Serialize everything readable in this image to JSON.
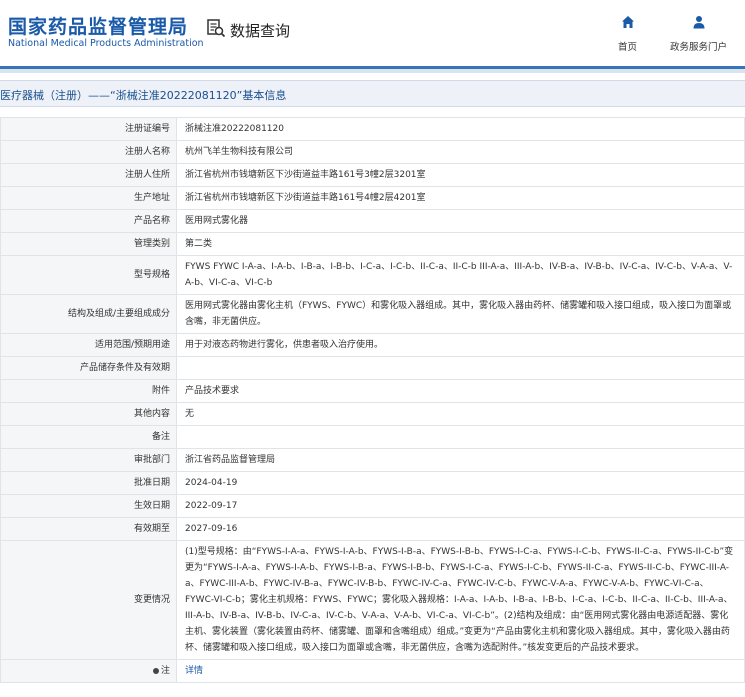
{
  "header": {
    "logo_cn": "国家药品监督管理局",
    "logo_en": "National Medical Products Administration",
    "search_title": "数据查询",
    "nav_home": "首页",
    "nav_service": "政务服务门户"
  },
  "page_title": "医疗器械（注册）——“浙械注准20222081120”基本信息",
  "rows": [
    {
      "label": "注册证编号",
      "value": "浙械注准20222081120"
    },
    {
      "label": "注册人名称",
      "value": "杭州飞羊生物科技有限公司"
    },
    {
      "label": "注册人住所",
      "value": "浙江省杭州市钱塘新区下沙街道益丰路161号3幢2层3201室"
    },
    {
      "label": "生产地址",
      "value": "浙江省杭州市钱塘新区下沙街道益丰路161号4幢2层4201室"
    },
    {
      "label": "产品名称",
      "value": "医用网式雾化器"
    },
    {
      "label": "管理类别",
      "value": "第二类"
    },
    {
      "label": "型号规格",
      "value": "FYWS FYWC I-A-a、I-A-b、I-B-a、I-B-b、I-C-a、I-C-b、II-C-a、II-C-b III-A-a、III-A-b、IV-B-a、IV-B-b、IV-C-a、IV-C-b、V-A-a、V-A-b、VI-C-a、VI-C-b"
    },
    {
      "label": "结构及组成/主要组成成分",
      "value": "医用网式雾化器由雾化主机（FYWS、FYWC）和雾化吸入器组成。其中，雾化吸入器由药杯、储雾罐和吸入接口组成，吸入接口为面罩或含嘴，非无菌供应。"
    },
    {
      "label": "适用范围/预期用途",
      "value": "用于对液态药物进行雾化，供患者吸入治疗使用。"
    },
    {
      "label": "产品储存条件及有效期",
      "value": ""
    },
    {
      "label": "附件",
      "value": "产品技术要求"
    },
    {
      "label": "其他内容",
      "value": "无"
    },
    {
      "label": "备注",
      "value": ""
    },
    {
      "label": "审批部门",
      "value": "浙江省药品监督管理局"
    },
    {
      "label": "批准日期",
      "value": "2024-04-19"
    },
    {
      "label": "生效日期",
      "value": "2022-09-17"
    },
    {
      "label": "有效期至",
      "value": "2027-09-16"
    },
    {
      "label": "变更情况",
      "value": "(1)型号规格：由“FYWS-I-A-a、FYWS-I-A-b、FYWS-I-B-a、FYWS-I-B-b、FYWS-I-C-a、FYWS-I-C-b、FYWS-II-C-a、FYWS-II-C-b”变更为“FYWS-I-A-a、FYWS-I-A-b、FYWS-I-B-a、FYWS-I-B-b、FYWS-I-C-a、FYWS-I-C-b、FYWS-II-C-a、FYWS-II-C-b、FYWC-III-A-a、FYWC-III-A-b、FYWC-IV-B-a、FYWC-IV-B-b、FYWC-IV-C-a、FYWC-IV-C-b、FYWC-V-A-a、FYWC-V-A-b、FYWC-VI-C-a、FYWC-VI-C-b；雾化主机规格：FYWS、FYWC；雾化吸入器规格：I-A-a、I-A-b、I-B-a、I-B-b、I-C-a、I-C-b、II-C-a、II-C-b、III-A-a、III-A-b、IV-B-a、IV-B-b、IV-C-a、IV-C-b、V-A-a、V-A-b、VI-C-a、VI-C-b”。(2)结构及组成：由“医用网式雾化器由电源适配器、雾化主机、雾化装置（雾化装置由药杯、储雾罐、面罩和含嘴组成）组成。”变更为“产品由雾化主机和雾化吸入器组成。其中，雾化吸入器由药杯、储雾罐和吸入接口组成，吸入接口为面罩或含嘴，非无菌供应，含嘴为选配附件。”核发变更后的产品技术要求。"
    }
  ],
  "note": {
    "label": "注",
    "value": "详情"
  }
}
